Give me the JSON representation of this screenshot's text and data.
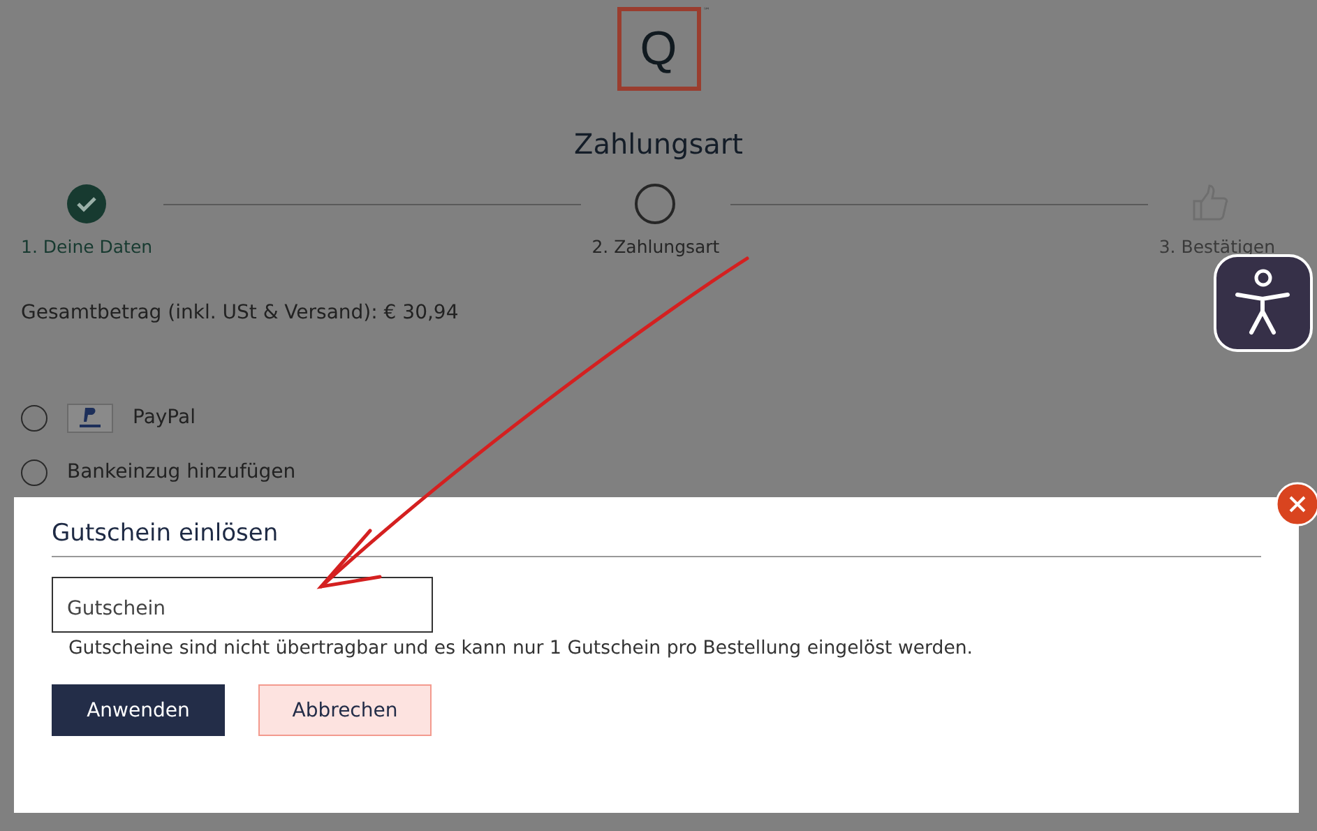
{
  "logo": {
    "letter": "Q",
    "mark": "℠"
  },
  "page_title": "Zahlungsart",
  "steps": [
    {
      "label": "1. Deine Daten",
      "completed": true,
      "selected": false
    },
    {
      "label": "2. Zahlungsart",
      "completed": false,
      "selected": true
    },
    {
      "label": "3. Bestätigen",
      "completed": false,
      "selected": false
    }
  ],
  "total": "Gesamtbetrag (inkl. USt & Versand): € 30,94",
  "payment_options": [
    {
      "label": "PayPal",
      "kind": "paypal",
      "selected": false
    },
    {
      "label": "Bankeinzug hinzufügen",
      "kind": "plain",
      "selected": false
    }
  ],
  "dialog": {
    "title": "Gutschein einlösen",
    "field": {
      "placeholder": "Gutschein"
    },
    "hint": "Gutscheine sind nicht übertragbar und es kann nur 1 Gutschein pro Bestellung eingelöst werden.",
    "buttons": [
      {
        "label": "Anwenden",
        "kind": "primary"
      },
      {
        "label": "Abbrechen",
        "kind": "secondary"
      }
    ]
  }
}
